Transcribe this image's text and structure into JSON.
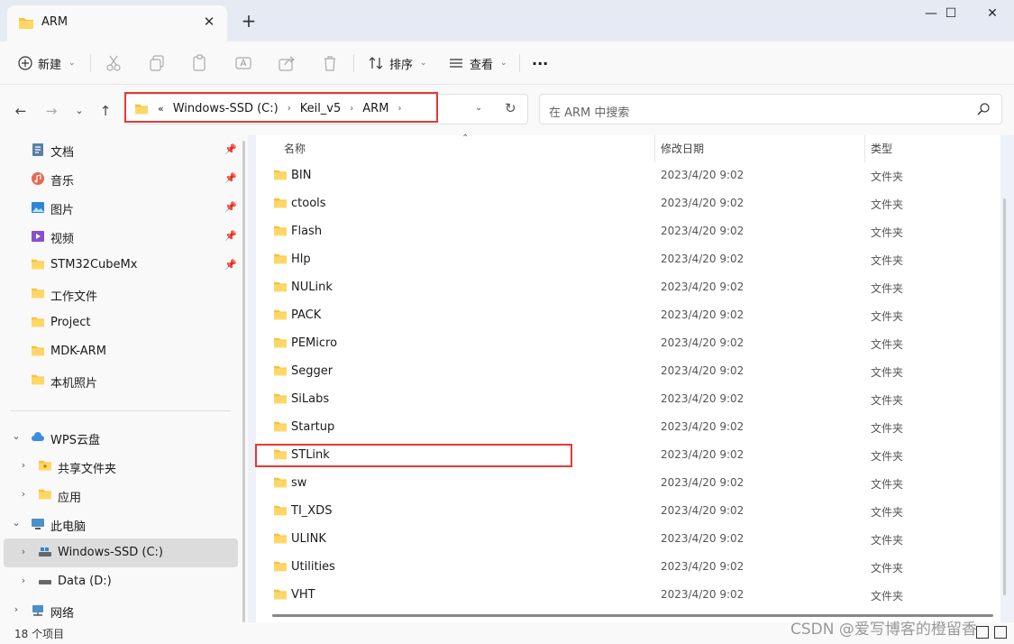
{
  "window": {
    "tab_title": "ARM",
    "tab_close": "✕",
    "new_tab": "+",
    "minimize": "—",
    "maximize": "☐",
    "close": "✕"
  },
  "toolbar": {
    "new_label": "新建",
    "sort_label": "排序",
    "view_label": "查看",
    "more_label": "···"
  },
  "address": {
    "overflow": "«",
    "crumbs": [
      "Windows-SSD (C:)",
      "Keil_v5",
      "ARM"
    ],
    "separator": "›"
  },
  "search": {
    "placeholder": "在 ARM 中搜索"
  },
  "sidebar": {
    "quick_access": [
      {
        "label": "文档",
        "icon": "documents-icon",
        "pinned": true
      },
      {
        "label": "音乐",
        "icon": "music-icon",
        "pinned": true
      },
      {
        "label": "图片",
        "icon": "pictures-icon",
        "pinned": true
      },
      {
        "label": "视频",
        "icon": "videos-icon",
        "pinned": true
      },
      {
        "label": "STM32CubeMx",
        "icon": "folder-icon",
        "pinned": true
      },
      {
        "label": "工作文件",
        "icon": "folder-icon",
        "pinned": false
      },
      {
        "label": "Project",
        "icon": "folder-icon",
        "pinned": false
      },
      {
        "label": "MDK-ARM",
        "icon": "folder-icon",
        "pinned": false
      },
      {
        "label": "本机照片",
        "icon": "folder-icon",
        "pinned": false
      }
    ],
    "tree": [
      {
        "label": "WPS云盘",
        "icon": "cloud-icon",
        "expander": "⌄",
        "level": 0
      },
      {
        "label": "共享文件夹",
        "icon": "shared-folder-icon",
        "expander": "›",
        "level": 1
      },
      {
        "label": "应用",
        "icon": "folder-icon",
        "expander": "›",
        "level": 1
      },
      {
        "label": "此电脑",
        "icon": "computer-icon",
        "expander": "⌄",
        "level": 0
      },
      {
        "label": "Windows-SSD (C:)",
        "icon": "drive-c-icon",
        "expander": "›",
        "level": 1,
        "selected": true
      },
      {
        "label": "Data (D:)",
        "icon": "drive-d-icon",
        "expander": "›",
        "level": 1
      },
      {
        "label": "网络",
        "icon": "network-icon",
        "expander": "›",
        "level": 0
      }
    ]
  },
  "columns": {
    "name": "名称",
    "modified": "修改日期",
    "type": "类型"
  },
  "files": [
    {
      "name": "BIN",
      "modified": "2023/4/20 9:02",
      "type": "文件夹"
    },
    {
      "name": "ctools",
      "modified": "2023/4/20 9:02",
      "type": "文件夹"
    },
    {
      "name": "Flash",
      "modified": "2023/4/20 9:02",
      "type": "文件夹"
    },
    {
      "name": "Hlp",
      "modified": "2023/4/20 9:02",
      "type": "文件夹"
    },
    {
      "name": "NULink",
      "modified": "2023/4/20 9:02",
      "type": "文件夹"
    },
    {
      "name": "PACK",
      "modified": "2023/4/20 9:02",
      "type": "文件夹"
    },
    {
      "name": "PEMicro",
      "modified": "2023/4/20 9:02",
      "type": "文件夹"
    },
    {
      "name": "Segger",
      "modified": "2023/4/20 9:02",
      "type": "文件夹"
    },
    {
      "name": "SiLabs",
      "modified": "2023/4/20 9:02",
      "type": "文件夹"
    },
    {
      "name": "Startup",
      "modified": "2023/4/20 9:02",
      "type": "文件夹"
    },
    {
      "name": "STLink",
      "modified": "2023/4/20 9:02",
      "type": "文件夹"
    },
    {
      "name": "sw",
      "modified": "2023/4/20 9:02",
      "type": "文件夹"
    },
    {
      "name": "TI_XDS",
      "modified": "2023/4/20 9:02",
      "type": "文件夹"
    },
    {
      "name": "ULINK",
      "modified": "2023/4/20 9:02",
      "type": "文件夹"
    },
    {
      "name": "Utilities",
      "modified": "2023/4/20 9:02",
      "type": "文件夹"
    },
    {
      "name": "VHT",
      "modified": "2023/4/20 9:02",
      "type": "文件夹"
    }
  ],
  "status": {
    "item_count": "18 个项目"
  },
  "watermark": "CSDN @爱写博客的橙留香",
  "colors": {
    "folder": "#f5c242",
    "highlight": "#e53935",
    "selected_bg": "#dcdcdc"
  }
}
